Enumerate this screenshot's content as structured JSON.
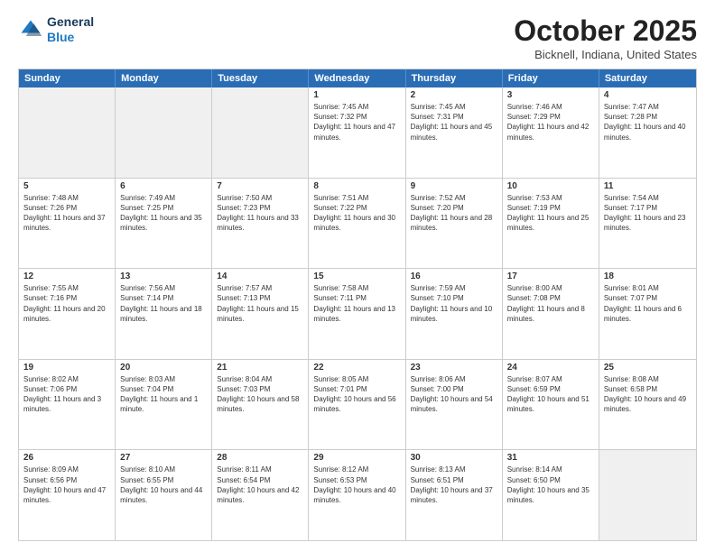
{
  "logo": {
    "line1": "General",
    "line2": "Blue"
  },
  "title": "October 2025",
  "location": "Bicknell, Indiana, United States",
  "header_days": [
    "Sunday",
    "Monday",
    "Tuesday",
    "Wednesday",
    "Thursday",
    "Friday",
    "Saturday"
  ],
  "weeks": [
    [
      {
        "day": "",
        "text": "",
        "shaded": true
      },
      {
        "day": "",
        "text": "",
        "shaded": true
      },
      {
        "day": "",
        "text": "",
        "shaded": true
      },
      {
        "day": "1",
        "text": "Sunrise: 7:45 AM\nSunset: 7:32 PM\nDaylight: 11 hours and 47 minutes."
      },
      {
        "day": "2",
        "text": "Sunrise: 7:45 AM\nSunset: 7:31 PM\nDaylight: 11 hours and 45 minutes."
      },
      {
        "day": "3",
        "text": "Sunrise: 7:46 AM\nSunset: 7:29 PM\nDaylight: 11 hours and 42 minutes."
      },
      {
        "day": "4",
        "text": "Sunrise: 7:47 AM\nSunset: 7:28 PM\nDaylight: 11 hours and 40 minutes."
      }
    ],
    [
      {
        "day": "5",
        "text": "Sunrise: 7:48 AM\nSunset: 7:26 PM\nDaylight: 11 hours and 37 minutes."
      },
      {
        "day": "6",
        "text": "Sunrise: 7:49 AM\nSunset: 7:25 PM\nDaylight: 11 hours and 35 minutes."
      },
      {
        "day": "7",
        "text": "Sunrise: 7:50 AM\nSunset: 7:23 PM\nDaylight: 11 hours and 33 minutes."
      },
      {
        "day": "8",
        "text": "Sunrise: 7:51 AM\nSunset: 7:22 PM\nDaylight: 11 hours and 30 minutes."
      },
      {
        "day": "9",
        "text": "Sunrise: 7:52 AM\nSunset: 7:20 PM\nDaylight: 11 hours and 28 minutes."
      },
      {
        "day": "10",
        "text": "Sunrise: 7:53 AM\nSunset: 7:19 PM\nDaylight: 11 hours and 25 minutes."
      },
      {
        "day": "11",
        "text": "Sunrise: 7:54 AM\nSunset: 7:17 PM\nDaylight: 11 hours and 23 minutes."
      }
    ],
    [
      {
        "day": "12",
        "text": "Sunrise: 7:55 AM\nSunset: 7:16 PM\nDaylight: 11 hours and 20 minutes."
      },
      {
        "day": "13",
        "text": "Sunrise: 7:56 AM\nSunset: 7:14 PM\nDaylight: 11 hours and 18 minutes."
      },
      {
        "day": "14",
        "text": "Sunrise: 7:57 AM\nSunset: 7:13 PM\nDaylight: 11 hours and 15 minutes."
      },
      {
        "day": "15",
        "text": "Sunrise: 7:58 AM\nSunset: 7:11 PM\nDaylight: 11 hours and 13 minutes."
      },
      {
        "day": "16",
        "text": "Sunrise: 7:59 AM\nSunset: 7:10 PM\nDaylight: 11 hours and 10 minutes."
      },
      {
        "day": "17",
        "text": "Sunrise: 8:00 AM\nSunset: 7:08 PM\nDaylight: 11 hours and 8 minutes."
      },
      {
        "day": "18",
        "text": "Sunrise: 8:01 AM\nSunset: 7:07 PM\nDaylight: 11 hours and 6 minutes."
      }
    ],
    [
      {
        "day": "19",
        "text": "Sunrise: 8:02 AM\nSunset: 7:06 PM\nDaylight: 11 hours and 3 minutes."
      },
      {
        "day": "20",
        "text": "Sunrise: 8:03 AM\nSunset: 7:04 PM\nDaylight: 11 hours and 1 minute."
      },
      {
        "day": "21",
        "text": "Sunrise: 8:04 AM\nSunset: 7:03 PM\nDaylight: 10 hours and 58 minutes."
      },
      {
        "day": "22",
        "text": "Sunrise: 8:05 AM\nSunset: 7:01 PM\nDaylight: 10 hours and 56 minutes."
      },
      {
        "day": "23",
        "text": "Sunrise: 8:06 AM\nSunset: 7:00 PM\nDaylight: 10 hours and 54 minutes."
      },
      {
        "day": "24",
        "text": "Sunrise: 8:07 AM\nSunset: 6:59 PM\nDaylight: 10 hours and 51 minutes."
      },
      {
        "day": "25",
        "text": "Sunrise: 8:08 AM\nSunset: 6:58 PM\nDaylight: 10 hours and 49 minutes."
      }
    ],
    [
      {
        "day": "26",
        "text": "Sunrise: 8:09 AM\nSunset: 6:56 PM\nDaylight: 10 hours and 47 minutes."
      },
      {
        "day": "27",
        "text": "Sunrise: 8:10 AM\nSunset: 6:55 PM\nDaylight: 10 hours and 44 minutes."
      },
      {
        "day": "28",
        "text": "Sunrise: 8:11 AM\nSunset: 6:54 PM\nDaylight: 10 hours and 42 minutes."
      },
      {
        "day": "29",
        "text": "Sunrise: 8:12 AM\nSunset: 6:53 PM\nDaylight: 10 hours and 40 minutes."
      },
      {
        "day": "30",
        "text": "Sunrise: 8:13 AM\nSunset: 6:51 PM\nDaylight: 10 hours and 37 minutes."
      },
      {
        "day": "31",
        "text": "Sunrise: 8:14 AM\nSunset: 6:50 PM\nDaylight: 10 hours and 35 minutes."
      },
      {
        "day": "",
        "text": "",
        "shaded": true
      }
    ]
  ]
}
